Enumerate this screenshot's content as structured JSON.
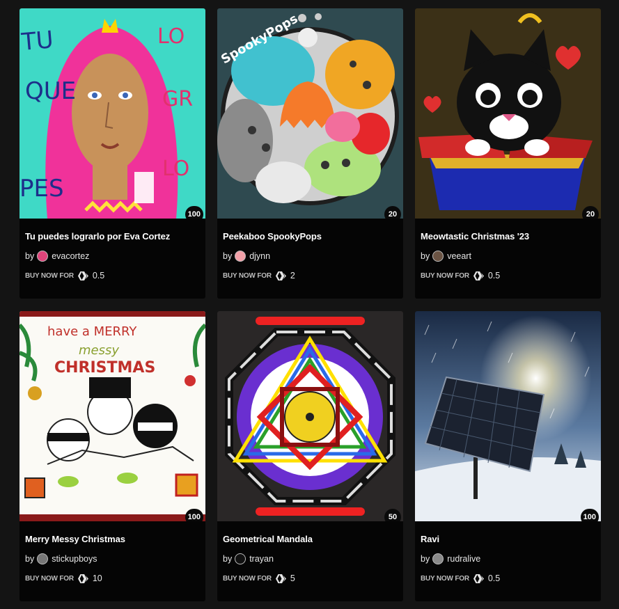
{
  "buy_label": "BUY NOW FOR",
  "by_label": "by",
  "cards": [
    {
      "title": "Tu puedes lograrlo por Eva Cortez",
      "author": "evacortez",
      "edition": "100",
      "price": "0.5",
      "avatar_color": "#e0457b"
    },
    {
      "title": "Peekaboo SpookyPops",
      "author": "djynn",
      "edition": "20",
      "price": "2",
      "avatar_color": "#f2a0a8"
    },
    {
      "title": "Meowtastic Christmas '23",
      "author": "veeart",
      "edition": "20",
      "price": "0.5",
      "avatar_color": "#6b5444"
    },
    {
      "title": "Merry Messy Christmas",
      "author": "stickupboys",
      "edition": "100",
      "price": "10",
      "avatar_color": "#777777"
    },
    {
      "title": "Geometrical Mandala",
      "author": "trayan",
      "edition": "50",
      "price": "5",
      "avatar_color": "#111111"
    },
    {
      "title": "Ravi",
      "author": "rudralive",
      "edition": "100",
      "price": "0.5",
      "avatar_color": "#8a8a8a"
    }
  ]
}
